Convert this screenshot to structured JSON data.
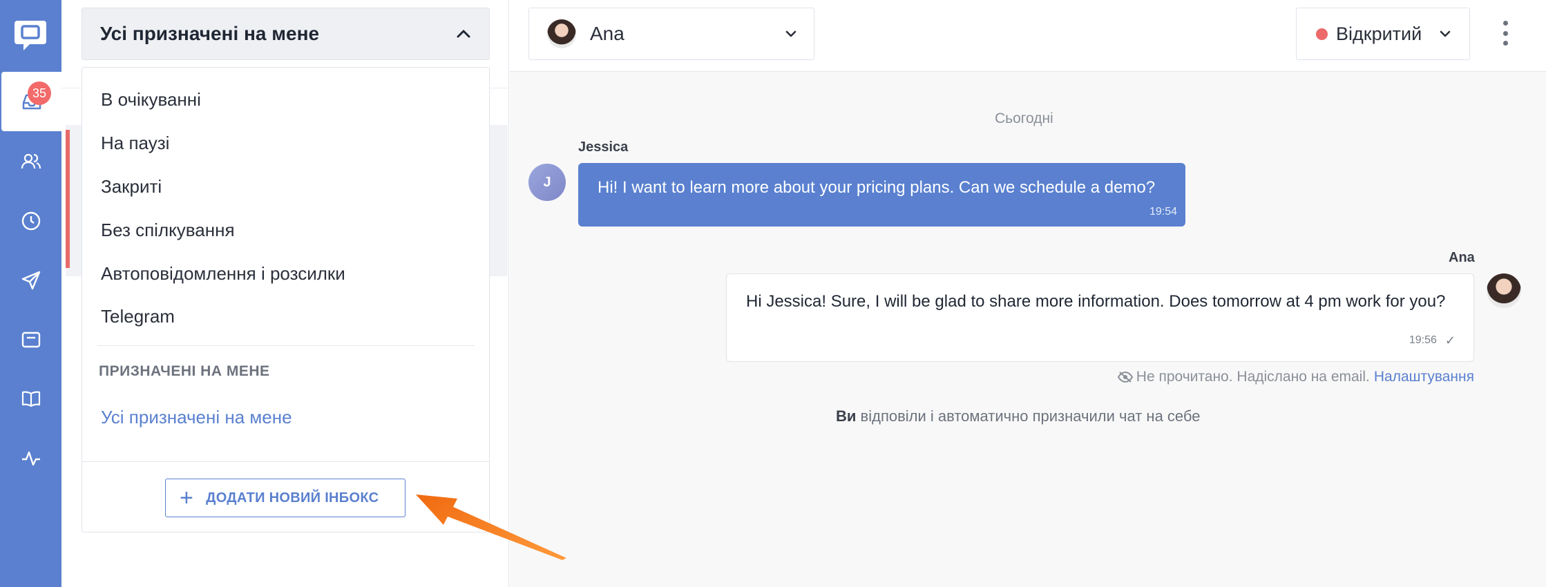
{
  "rail": {
    "badge_count": "35",
    "items": [
      "inbox-icon",
      "contacts-icon",
      "clock-icon",
      "send-icon",
      "widget-icon",
      "book-icon",
      "activity-icon"
    ]
  },
  "inbox_selector": {
    "label": "Усі призначені на мене"
  },
  "dropdown": {
    "items": [
      "В очікуванні",
      "На паузі",
      "Закриті",
      "Без спілкування",
      "Автоповідомлення і розсилки",
      "Telegram"
    ],
    "section_title": "ПРИЗНАЧЕНІ НА МЕНЕ",
    "section_link": "Усі призначені на мене",
    "add_button": "ДОДАТИ НОВИЙ ІНБОКС"
  },
  "header": {
    "agent": "Ana",
    "status": "Відкритий",
    "status_color": "#ec6a6a"
  },
  "conversation": {
    "date": "Сьогодні",
    "messages": [
      {
        "sender": "Jessica",
        "avatar_letter": "J",
        "text": "Hi! I want to learn more about your pricing plans. Can we schedule a demo?",
        "time": "19:54"
      },
      {
        "sender": "Ana",
        "text": "Hi Jessica! Sure, I will be glad to share more information. Does tomorrow at 4 pm work for you?",
        "time": "19:56"
      }
    ],
    "unread_note": "Не прочитано. Надіслано на email.",
    "settings_link": "Налаштування",
    "event_bold": "Ви",
    "event_text": " відповіли і автоматично призначили чат на себе"
  },
  "colors": {
    "accent": "#5a80cf",
    "badge": "#f26a6a",
    "annotation_arrow": "#f27a1a"
  }
}
